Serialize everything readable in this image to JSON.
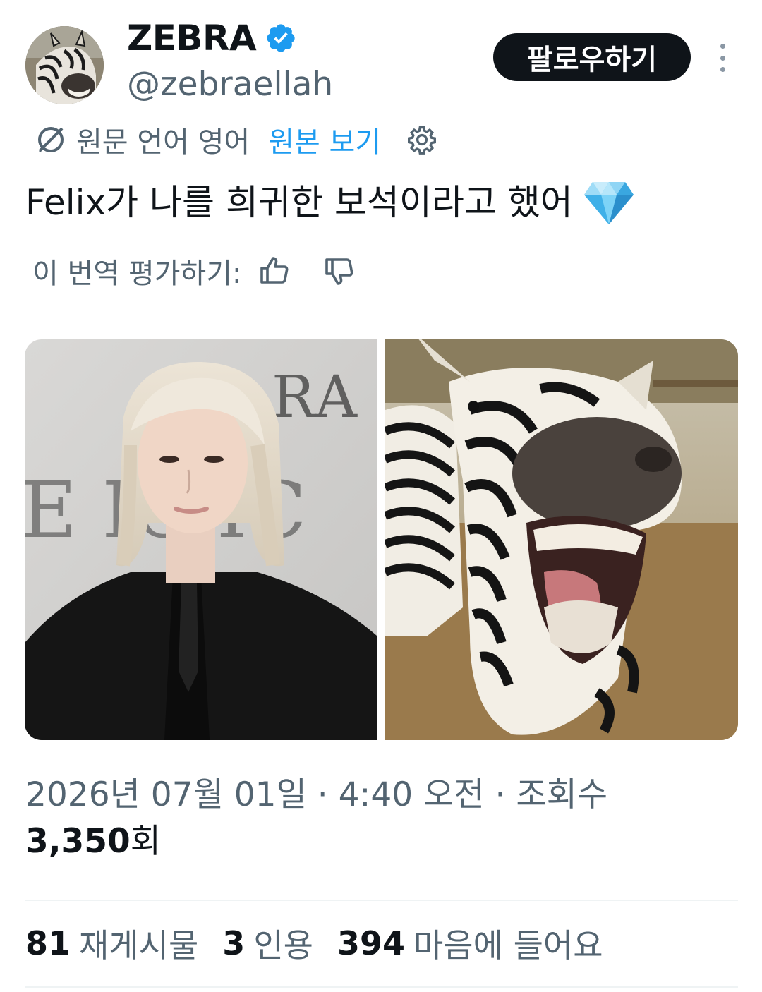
{
  "author": {
    "display_name": "ZEBRA",
    "handle": "@zebraellah",
    "verified_icon": "verified-badge-icon",
    "avatar_icon": "zebra-avatar"
  },
  "follow_label": "팔로우하기",
  "translation": {
    "label": "원문 언어 영어",
    "show_original": "원본 보기"
  },
  "tweet": {
    "text": "Felix가 나를 희귀한 보석이라고 했어",
    "emoji_icon": "gem-stone-icon"
  },
  "rate": {
    "label": "이 번역 평가하기:"
  },
  "media": {
    "left_sign_text": "RA",
    "left_sign_text_2": "E IC  IC",
    "right_alt": "zebra-photo"
  },
  "meta": {
    "datetime_views_label": "2026년 07월 01일 · 4:40 오전 · 조회수",
    "views_count": "3,350",
    "views_suffix": "회"
  },
  "stats": {
    "reposts_count": "81",
    "reposts_label": "재게시물",
    "quotes_count": "3",
    "quotes_label": "인용",
    "likes_count": "394",
    "likes_label": "마음에 들어요"
  },
  "colors": {
    "accent": "#1d9bf0",
    "text": "#0f1419",
    "muted": "#536471",
    "button_bg": "#0f1419"
  }
}
